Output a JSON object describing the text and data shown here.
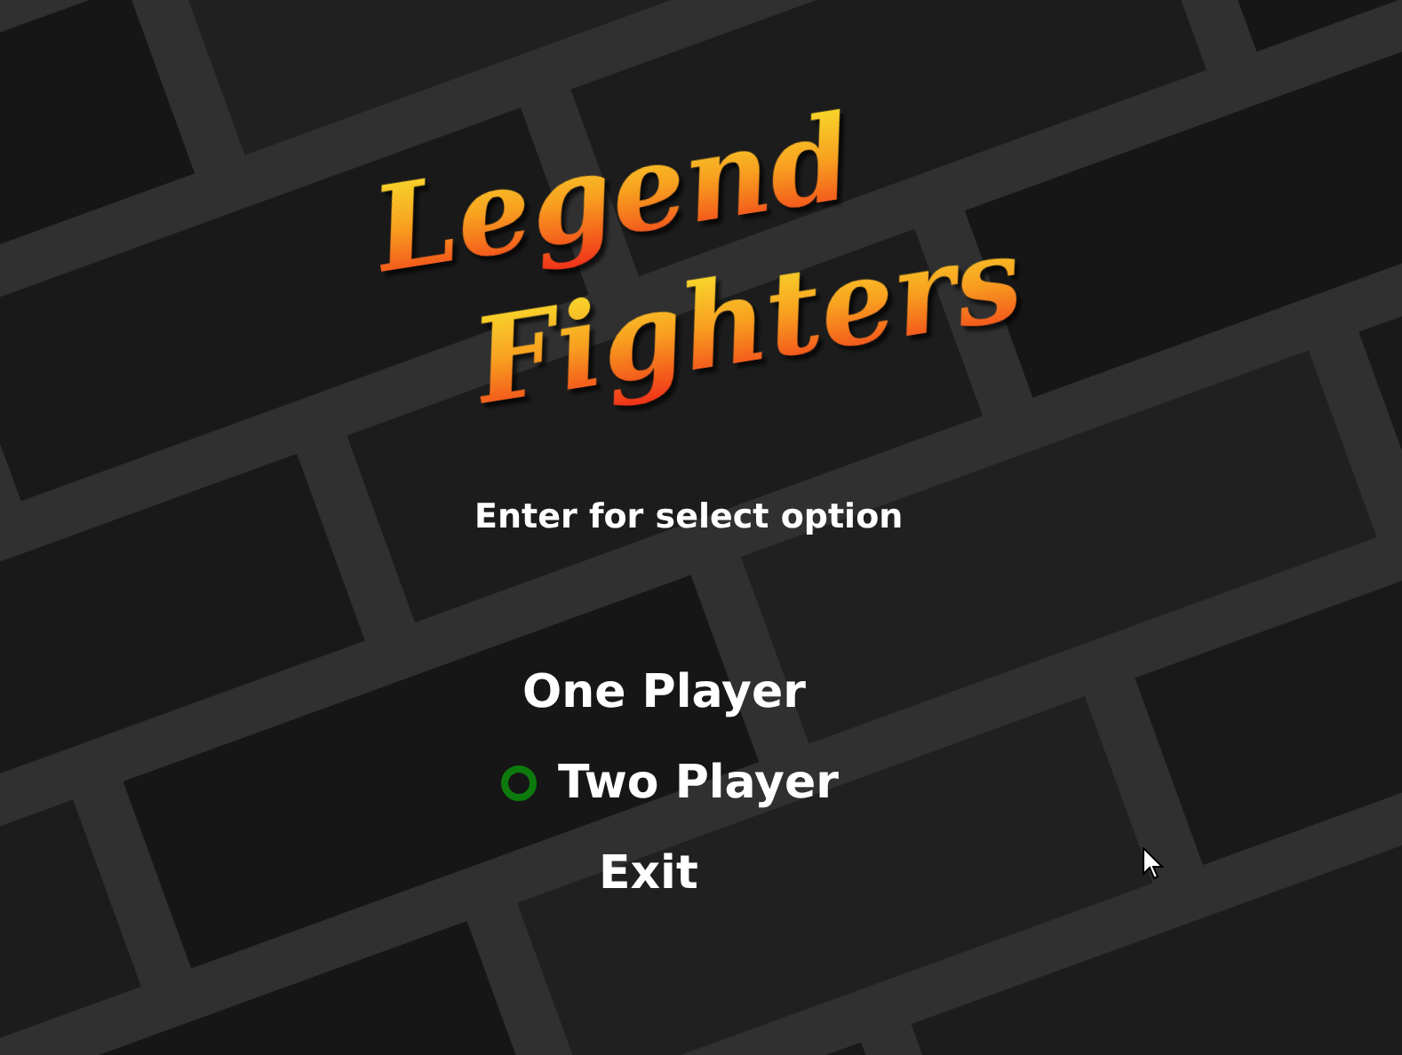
{
  "title": {
    "lines": [
      "Legend",
      "Fighters"
    ]
  },
  "hint": "Enter for select option",
  "menu": [
    {
      "label": "One Player",
      "selected": false
    },
    {
      "label": "Two Player",
      "selected": true
    },
    {
      "label": "Exit",
      "selected": false
    }
  ]
}
